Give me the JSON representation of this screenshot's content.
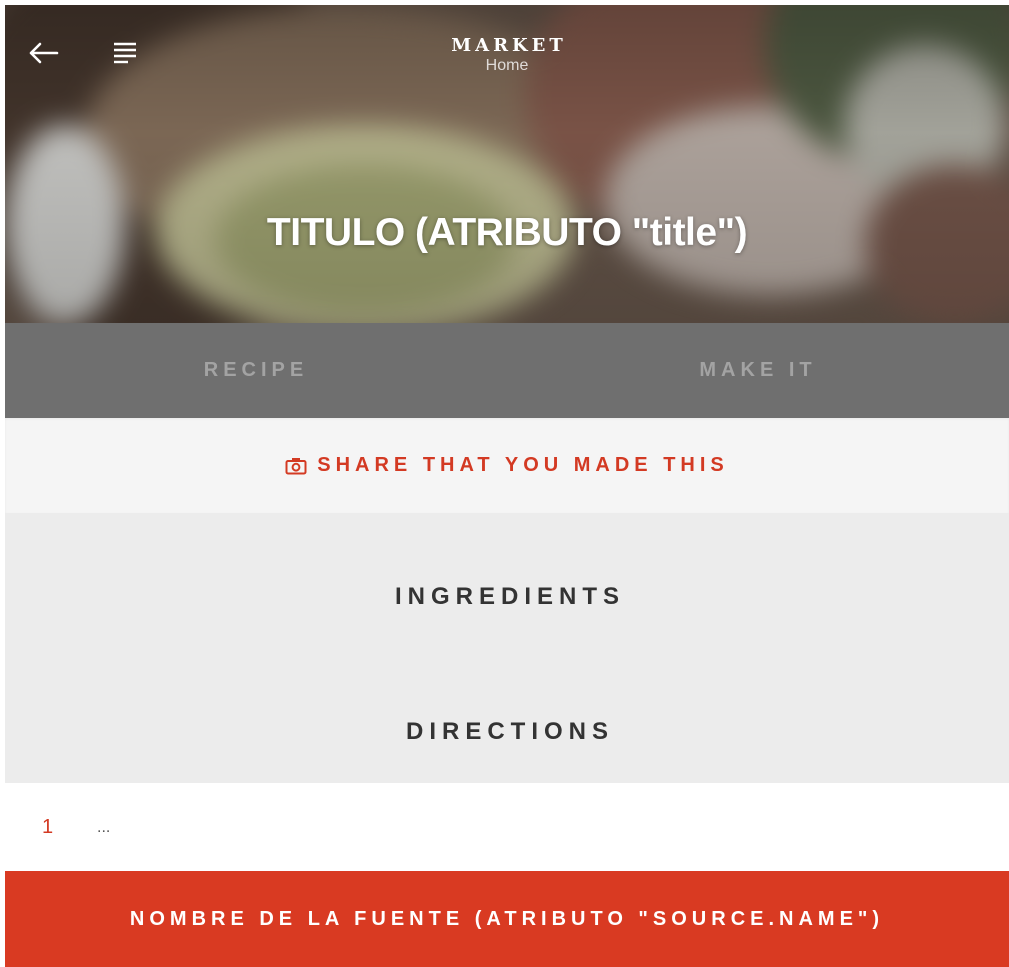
{
  "header": {
    "brand": "MARKET",
    "subtitle": "Home",
    "title": "TITULO (ATRIBUTO \"title\")"
  },
  "tabs": [
    {
      "label": "RECIPE"
    },
    {
      "label": "MAKE IT"
    }
  ],
  "share": {
    "label": "SHARE THAT YOU MADE THIS",
    "icon": "camera-icon"
  },
  "sections": {
    "ingredients": "INGREDIENTS",
    "directions": "DIRECTIONS"
  },
  "steps": [
    {
      "number": "1",
      "text": "..."
    }
  ],
  "source_button": {
    "label": "NOMBRE DE LA FUENTE (ATRIBUTO \"SOURCE.NAME\")"
  },
  "colors": {
    "accent": "#d93a22",
    "tab_bar": "#6f6f6f",
    "share_bg": "#f5f5f5",
    "section_bg": "#ececec"
  }
}
